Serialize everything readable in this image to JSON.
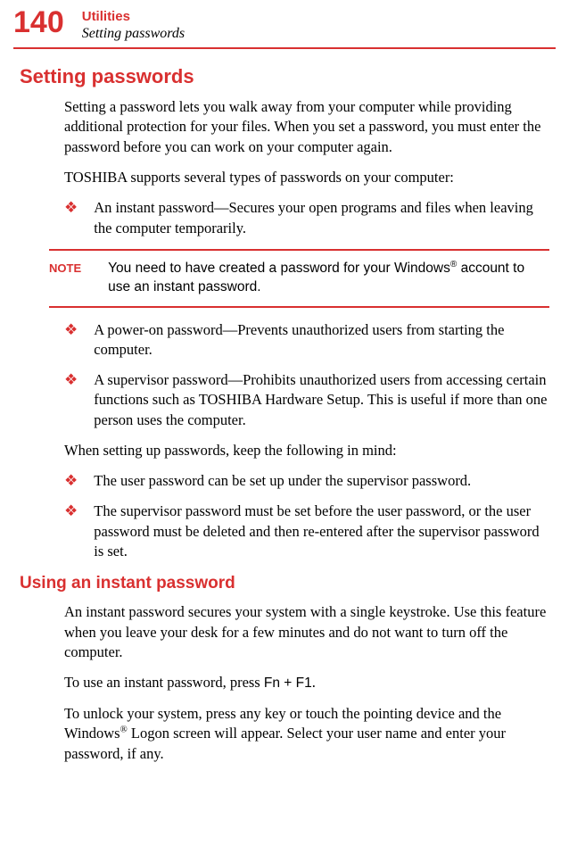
{
  "header": {
    "page_number": "140",
    "chapter": "Utilities",
    "section": "Setting passwords"
  },
  "h1": "Setting passwords",
  "p1": "Setting a password lets you walk away from your computer while providing additional protection for your files. When you set a password, you must enter the password before you can work on your computer again.",
  "p2": "TOSHIBA supports several types of passwords on your computer:",
  "bullet1": "An instant password—Secures your open programs and files when leaving the computer temporarily.",
  "note": {
    "label": "NOTE",
    "text_pre": "You need to have created a password for your Windows",
    "text_post": " account to use an instant password."
  },
  "bullet2": "A power-on password—Prevents unauthorized users from starting the computer.",
  "bullet3": "A supervisor password—Prohibits unauthorized users from accessing certain functions such as TOSHIBA Hardware Setup. This is useful if more than one person uses the computer.",
  "p3": "When setting up passwords, keep the following in mind:",
  "bullet4": "The user password can be set up under the supervisor password.",
  "bullet5": "The supervisor password must be set before the user password, or the user password must be deleted and then re-entered after the supervisor password is set.",
  "h2": "Using an instant password",
  "p4": "An instant password secures your system with a single keystroke. Use this feature when you leave your desk for a few minutes and do not want to turn off the computer.",
  "p5_pre": "To use an instant password, press ",
  "p5_key": "Fn + F1",
  "p5_post": ".",
  "p6_pre": "To unlock your system, press any key or touch the pointing device and the Windows",
  "p6_post": " Logon screen will appear. Select your user name and enter your password, if any.",
  "bullet_glyph": "❖",
  "reg_symbol": "®"
}
